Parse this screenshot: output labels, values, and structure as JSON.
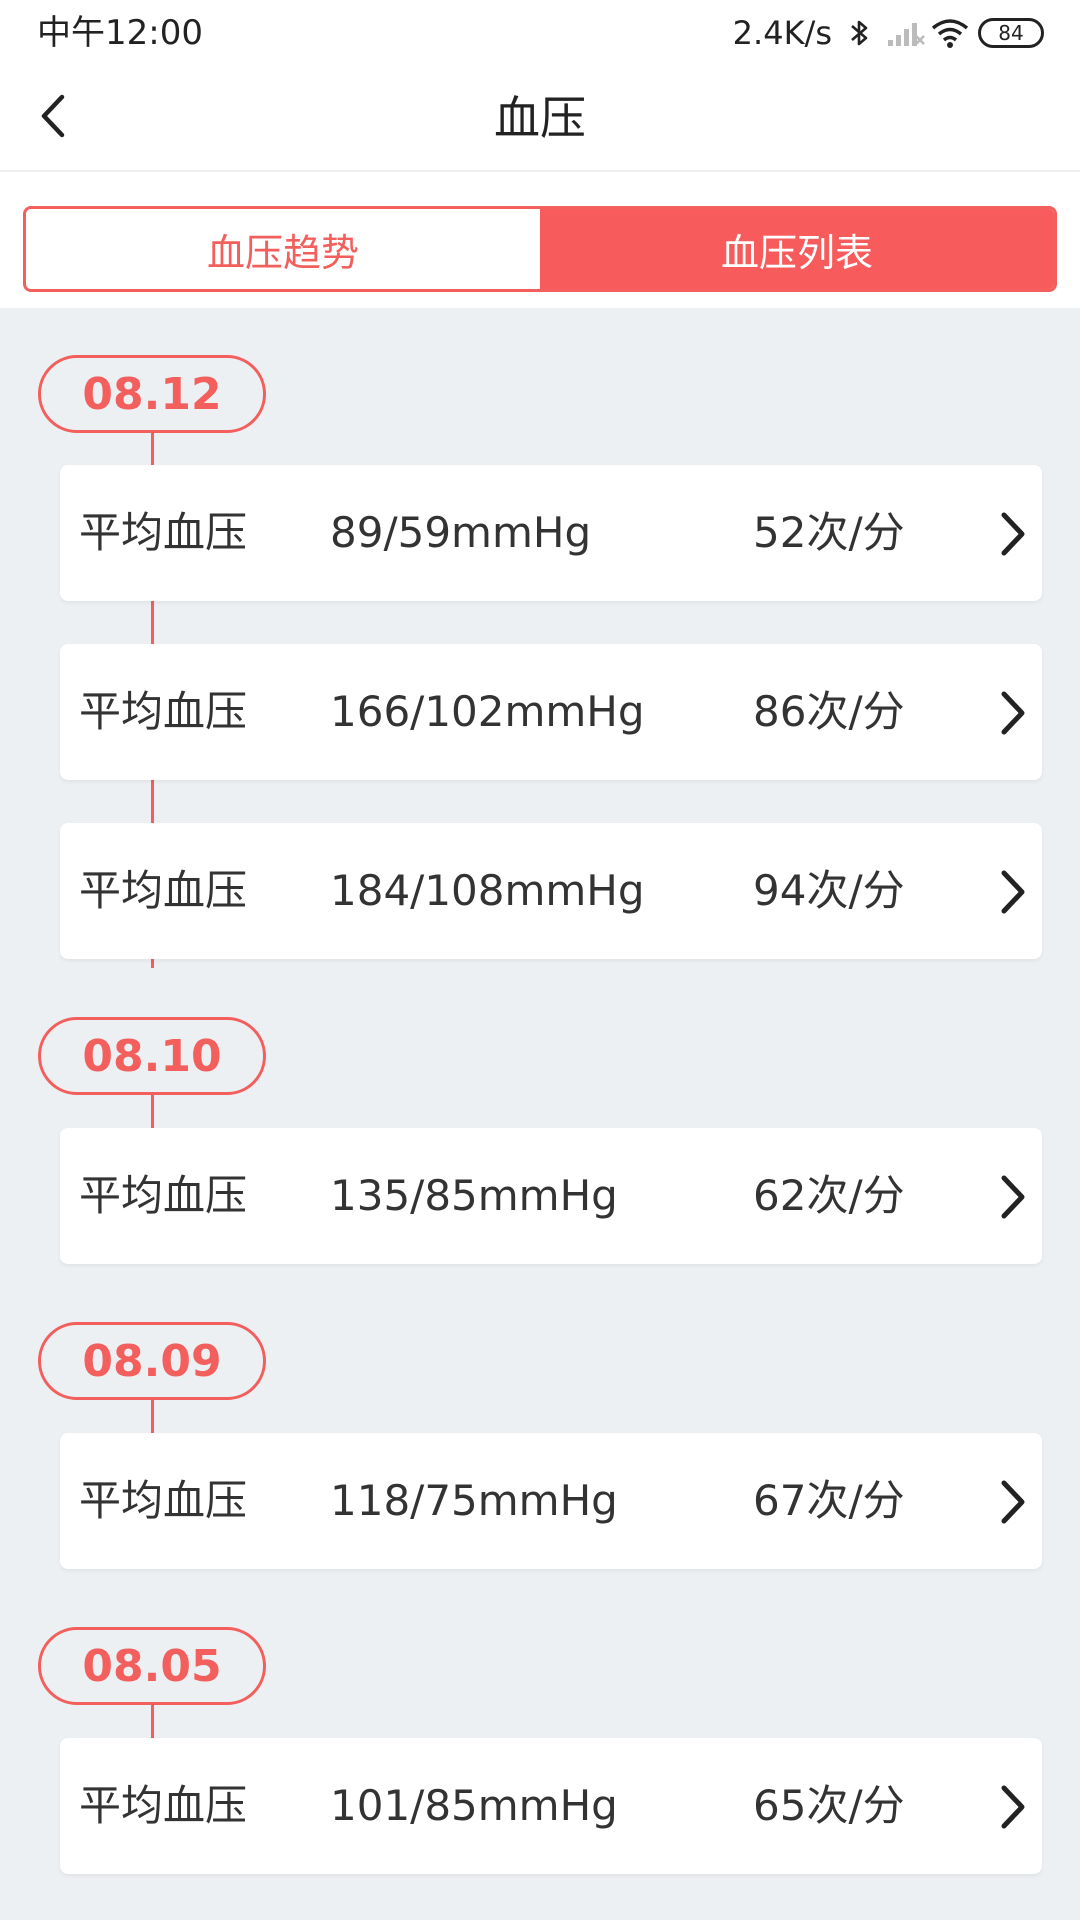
{
  "status_bar": {
    "time": "中午12:00",
    "net_speed": "2.4K/s",
    "icons": [
      "bluetooth-icon",
      "signal-icon",
      "wifi-icon"
    ],
    "battery": "84"
  },
  "nav": {
    "title": "血压",
    "back_icon": "chevron-left-icon"
  },
  "tabs": [
    {
      "label": "血压趋势",
      "active": false
    },
    {
      "label": "血压列表",
      "active": true
    }
  ],
  "colors": {
    "accent": "#f75b5b",
    "accent_border": "#f25f5c",
    "background": "#edf0f3",
    "card": "#ffffff"
  },
  "groups": [
    {
      "date": "08.12",
      "records": [
        {
          "label": "平均血压",
          "bp": "89/59mmHg",
          "heart_rate": "52次/分"
        },
        {
          "label": "平均血压",
          "bp": "166/102mmHg",
          "heart_rate": "86次/分"
        },
        {
          "label": "平均血压",
          "bp": "184/108mmHg",
          "heart_rate": "94次/分"
        }
      ]
    },
    {
      "date": "08.10",
      "records": [
        {
          "label": "平均血压",
          "bp": "135/85mmHg",
          "heart_rate": "62次/分"
        }
      ]
    },
    {
      "date": "08.09",
      "records": [
        {
          "label": "平均血压",
          "bp": "118/75mmHg",
          "heart_rate": "67次/分"
        }
      ]
    },
    {
      "date": "08.05",
      "records": [
        {
          "label": "平均血压",
          "bp": "101/85mmHg",
          "heart_rate": "65次/分"
        }
      ]
    }
  ]
}
